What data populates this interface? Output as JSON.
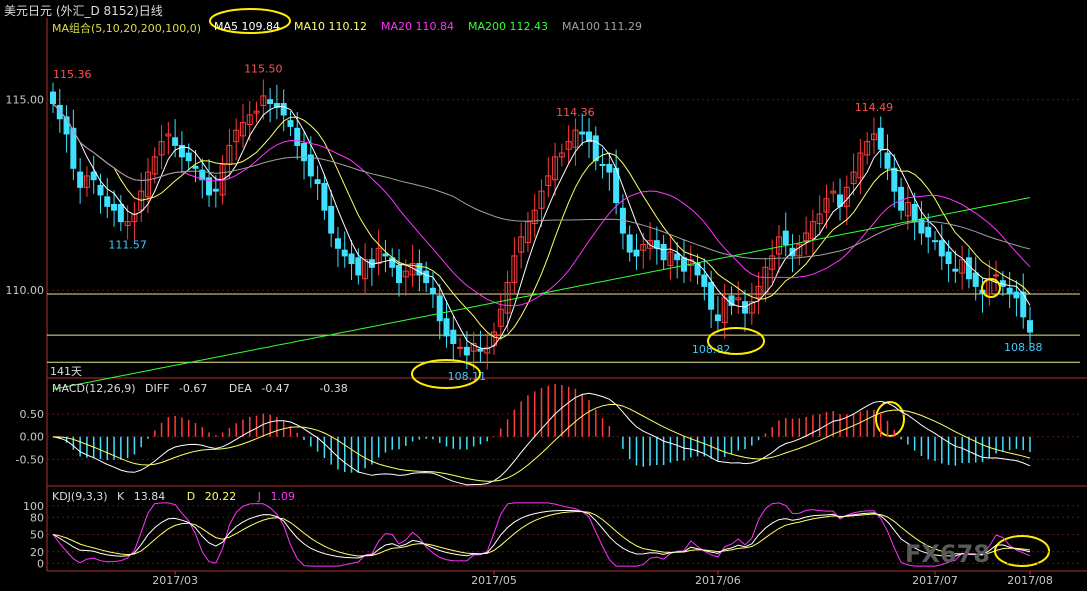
{
  "window": {
    "title": "美元日元 (外汇_D 8152)日线"
  },
  "ma_header": {
    "combo": "MA组合(5,10,20,200,100,0)",
    "items": [
      {
        "label": "MA5",
        "value": "109.84",
        "color": "#ffffff"
      },
      {
        "label": "MA10",
        "value": "110.12",
        "color": "#ffff66"
      },
      {
        "label": "MA20",
        "value": "110.84",
        "color": "#ff33ff"
      },
      {
        "label": "MA200",
        "value": "112.43",
        "color": "#33ff33"
      },
      {
        "label": "MA100",
        "value": "111.29",
        "color": "#a0a0a0"
      }
    ]
  },
  "price_labels": [
    {
      "text": "115.36",
      "color": "#ff5050"
    },
    {
      "text": "115.50",
      "color": "#ff5050"
    },
    {
      "text": "111.57",
      "color": "#40c8ff"
    },
    {
      "text": "114.36",
      "color": "#ff5050"
    },
    {
      "text": "108.11",
      "color": "#40c8ff"
    },
    {
      "text": "108.82",
      "color": "#40c8ff"
    },
    {
      "text": "114.49",
      "color": "#ff5050"
    },
    {
      "text": "108.88",
      "color": "#40c8ff"
    }
  ],
  "days_label": "141天",
  "macd_header": {
    "name": "MACD(12,26,9)",
    "diff_label": "DIFF",
    "diff": "-0.67",
    "dea_label": "DEA",
    "dea": "-0.47",
    "macd": "-0.38"
  },
  "kdj_header": {
    "name": "KDJ(9,3,3)",
    "k_label": "K",
    "k": "13.84",
    "d_label": "D",
    "d": "20.22",
    "j_label": "J",
    "j": "1.09"
  },
  "watermark": "FX678",
  "colors": {
    "up": "#ff3c3c",
    "down": "#40e0ff",
    "ma5": "#ffffff",
    "ma10": "#ffff66",
    "ma20": "#ff33ff",
    "ma200": "#33ff33",
    "ma100": "#a0a0a0",
    "highlight": "#ffee00"
  },
  "chart_data": [
    {
      "type": "candlestick",
      "title": "美元日元 (外汇_D 8152)日线",
      "x_ticks": [
        "2017/03",
        "2017/05",
        "2017/06",
        "2017/07",
        "2017/08"
      ],
      "y_ticks": [
        115.0,
        110.0
      ],
      "ylim": [
        107.8,
        116.2
      ],
      "horizontal_lines": [
        109.9,
        108.82,
        108.11
      ],
      "series": [
        {
          "name": "MA5",
          "value_last": 109.84
        },
        {
          "name": "MA10",
          "value_last": 110.12
        },
        {
          "name": "MA20",
          "value_last": 110.84
        },
        {
          "name": "MA200",
          "value_last": 112.43
        },
        {
          "name": "MA100",
          "value_last": 111.29
        }
      ],
      "annotations": [
        {
          "text": "115.36",
          "value": 115.36
        },
        {
          "text": "115.50",
          "value": 115.5
        },
        {
          "text": "111.57",
          "value": 111.57
        },
        {
          "text": "114.36",
          "value": 114.36
        },
        {
          "text": "108.11",
          "value": 108.11
        },
        {
          "text": "108.82",
          "value": 108.82
        },
        {
          "text": "114.49",
          "value": 114.49
        },
        {
          "text": "108.88",
          "value": 108.88
        }
      ],
      "close": [
        114.9,
        114.5,
        114.1,
        113.2,
        112.7,
        113.0,
        112.9,
        112.5,
        112.2,
        112.1,
        111.8,
        111.8,
        112.0,
        112.6,
        113.1,
        113.5,
        113.9,
        114.1,
        113.8,
        113.5,
        113.4,
        113.2,
        112.9,
        112.5,
        112.6,
        113.3,
        113.8,
        114.2,
        114.4,
        114.6,
        114.7,
        115.1,
        114.9,
        114.8,
        114.6,
        114.3,
        113.8,
        113.4,
        113.0,
        112.8,
        112.1,
        111.5,
        111.1,
        110.9,
        110.7,
        110.4,
        110.8,
        110.6,
        111.1,
        110.9,
        110.6,
        110.2,
        110.5,
        110.7,
        110.4,
        110.2,
        109.9,
        109.2,
        108.8,
        108.6,
        108.5,
        108.3,
        108.6,
        108.4,
        108.5,
        108.9,
        109.5,
        110.2,
        110.9,
        111.4,
        111.8,
        112.1,
        112.6,
        113.0,
        113.5,
        113.6,
        113.9,
        114.2,
        114.1,
        113.9,
        113.4,
        113.3,
        113.1,
        112.3,
        111.5,
        111.0,
        110.9,
        111.2,
        111.3,
        111.1,
        110.8,
        111.0,
        110.8,
        110.5,
        110.8,
        110.4,
        110.1,
        109.5,
        109.2,
        109.8,
        109.6,
        109.8,
        109.4,
        109.7,
        110.1,
        110.6,
        110.9,
        111.4,
        111.2,
        110.9,
        111.2,
        111.5,
        111.8,
        112.0,
        112.4,
        112.6,
        112.2,
        112.7,
        113.1,
        113.6,
        113.9,
        114.1,
        113.7,
        113.2,
        112.6,
        112.1,
        112.3,
        111.8,
        111.5,
        111.4,
        111.3,
        110.9,
        110.7,
        110.5,
        110.8,
        110.3,
        110.1,
        109.9,
        110.3,
        110.4,
        110.1,
        109.9,
        109.8,
        109.3,
        108.9
      ]
    },
    {
      "type": "bar",
      "title": "MACD(12,26,9)",
      "y_ticks": [
        0.5,
        0.0,
        -0.5
      ],
      "ylim": [
        -1.0,
        0.9
      ],
      "series": [
        {
          "name": "DIFF",
          "value_last": -0.67
        },
        {
          "name": "DEA",
          "value_last": -0.47
        },
        {
          "name": "MACD",
          "value_last": -0.38
        }
      ]
    },
    {
      "type": "line",
      "title": "KDJ(9,3,3)",
      "y_ticks": [
        100,
        80,
        50,
        20,
        0
      ],
      "ylim": [
        -10,
        110
      ],
      "series": [
        {
          "name": "K",
          "value_last": 13.84
        },
        {
          "name": "D",
          "value_last": 20.22
        },
        {
          "name": "J",
          "value_last": 1.09
        }
      ]
    }
  ]
}
